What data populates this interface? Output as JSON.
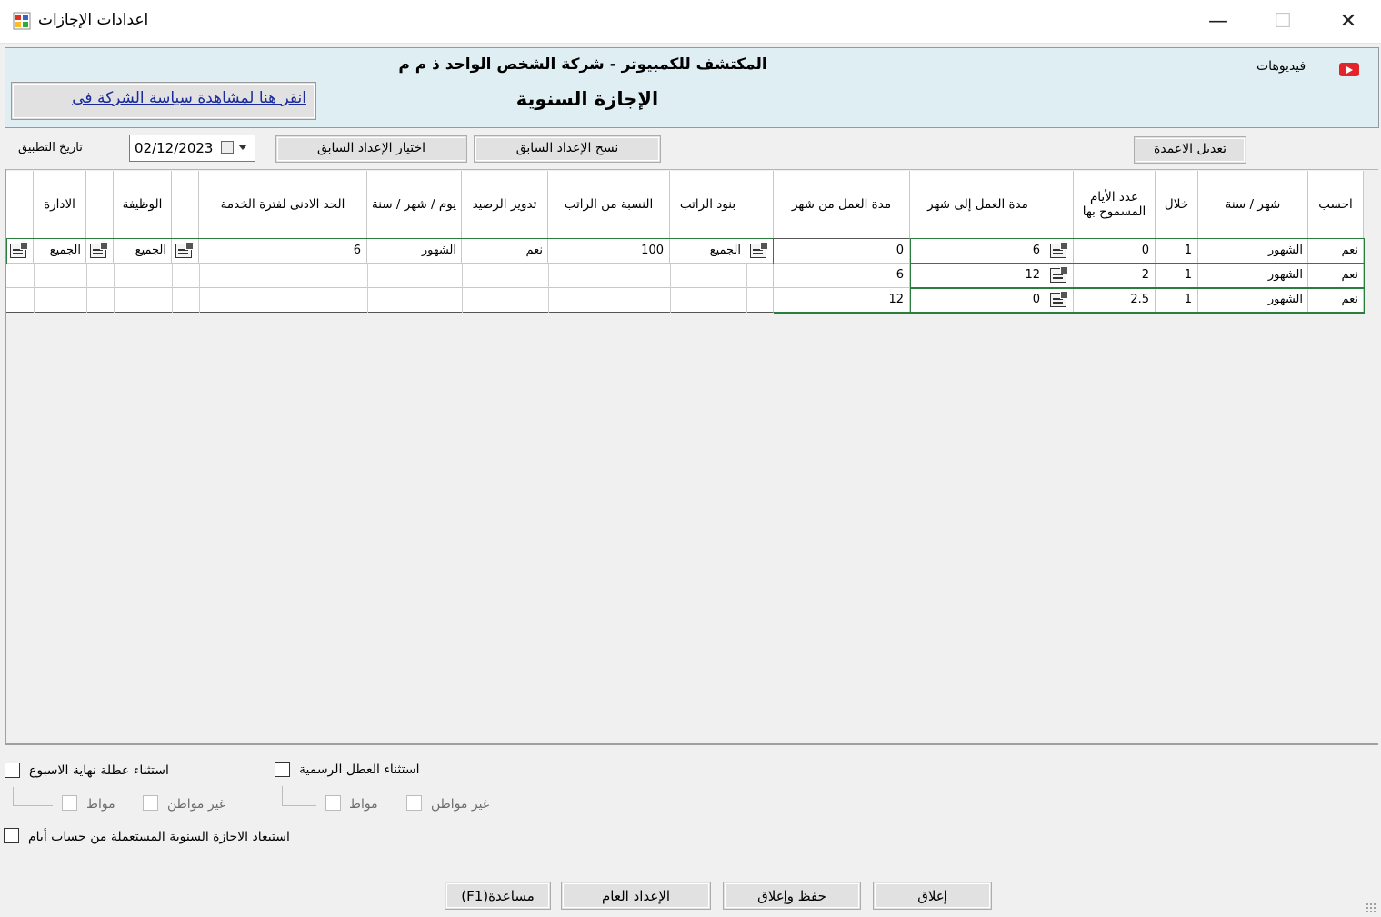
{
  "window": {
    "title": "اعدادات الإجازات",
    "controls": [
      "—",
      "☐",
      "✕"
    ]
  },
  "header": {
    "company": "المكتشف للكمبيوتر - شركة الشخص الواحد ذ م م",
    "heading": "الإجازة السنوية",
    "policy_link": "انقر هنا لمشاهدة سياسة الشركة فى",
    "videos_label": "فيديوهات"
  },
  "toolbar": {
    "application_date_label": "تاريخ التطبيق",
    "application_date": "02/12/2023",
    "select_previous_label": "اختيار الإعداد السابق",
    "copy_previous_label": "نسخ الإعداد السابق",
    "edit_columns_label": "تعديل الاعمدة"
  },
  "left_grid": {
    "headers": [
      "الادارة",
      "الوظيفة",
      "الحد الادنى لفترة الخدمة",
      "يوم / شهر / سنة",
      "تدوير الرصيد",
      "النسبة من الراتب",
      "بنود الراتب"
    ],
    "row": {
      "department": "الجميع",
      "job": "الجميع",
      "min_service": "6",
      "period_unit": "الشهور",
      "carry_over": "نعم",
      "salary_percent": "100",
      "salary_items": "الجميع"
    }
  },
  "right_grid": {
    "headers": [
      "مدة العمل من شهر",
      "مدة العمل إلى شهر",
      "عدد الأيام المسموح بها",
      "خلال",
      "شهر / سنة",
      "احسب"
    ],
    "rows": [
      {
        "from_month": "0",
        "to_month": "6",
        "allowed_days": "0",
        "within": "1",
        "month_year": "الشهور",
        "calculate": "نعم"
      },
      {
        "from_month": "6",
        "to_month": "12",
        "allowed_days": "2",
        "within": "1",
        "month_year": "الشهور",
        "calculate": "نعم"
      },
      {
        "from_month": "12",
        "to_month": "0",
        "allowed_days": "2.5",
        "within": "1",
        "month_year": "الشهور",
        "calculate": "نعم"
      }
    ]
  },
  "options": {
    "exclude_weekend_label": "استثناء عطلة نهاية الاسبوع",
    "exclude_holidays_label": "استثناء العطل الرسمية",
    "citizen_label": "مواط",
    "non_citizen_label": "غير مواطن",
    "exclude_annual_used_label": "استبعاد الاجازة السنوية المستعملة من حساب أيام"
  },
  "footer": {
    "help_label": "(F1)مساعدة",
    "general_settings_label": "الإعداد العام",
    "save_close_label": "حفظ وإغلاق",
    "close_label": "إغلاق"
  }
}
